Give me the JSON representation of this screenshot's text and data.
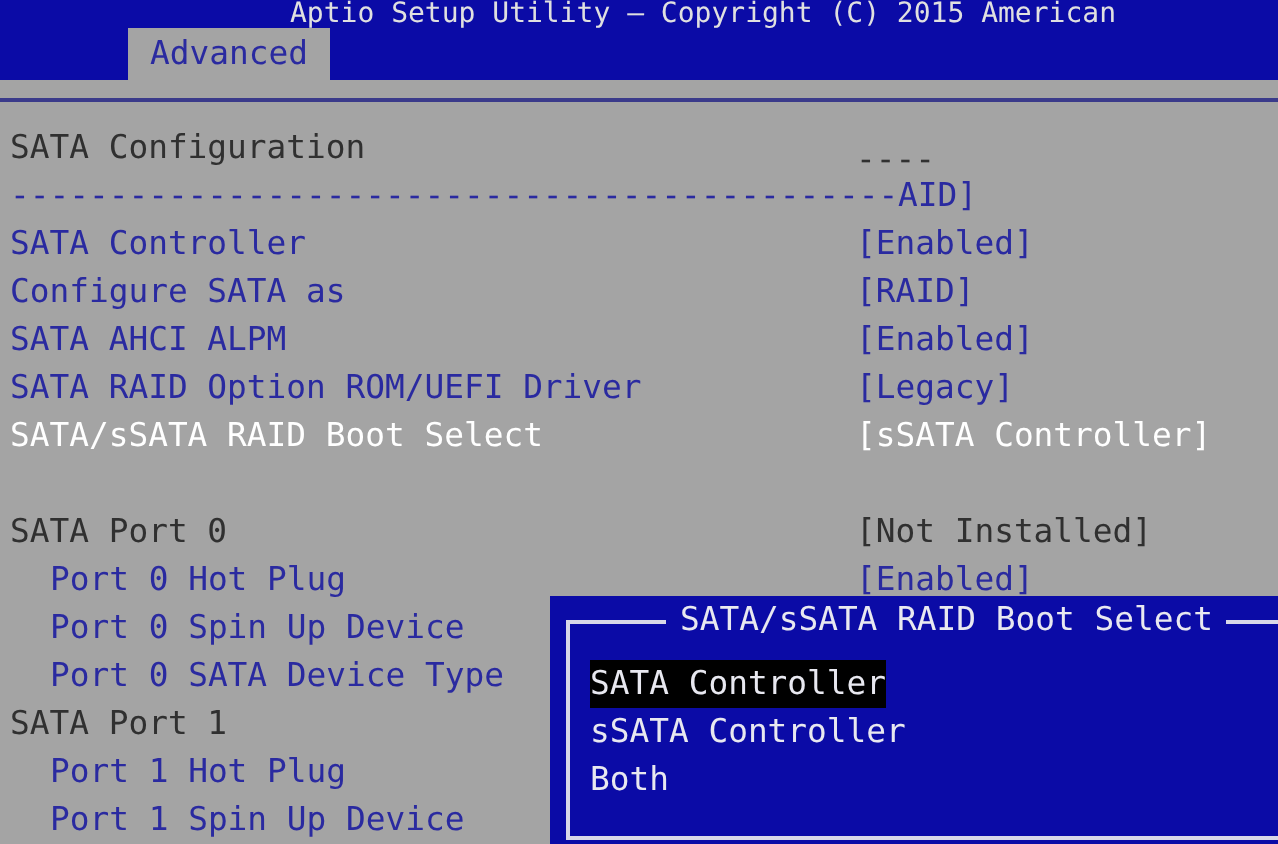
{
  "window": {
    "title": "Aptio Setup Utility – Copyright (C) 2015 American"
  },
  "tabs": [
    {
      "label": "Advanced",
      "selected": true
    }
  ],
  "page": {
    "title": "SATA Configuration",
    "help_fragment": "----",
    "divider_text": "---------------------------------------------AID]"
  },
  "items": [
    {
      "kind": "option",
      "label": "SATA Controller",
      "value": "[Enabled]",
      "selected": false
    },
    {
      "kind": "option",
      "label": "Configure SATA as",
      "value": "[RAID]",
      "selected": false
    },
    {
      "kind": "option",
      "label": "SATA AHCI ALPM",
      "value": "[Enabled]",
      "selected": false
    },
    {
      "kind": "option",
      "label": "SATA RAID Option ROM/UEFI Driver",
      "value": "[Legacy]",
      "selected": false
    },
    {
      "kind": "option",
      "label": "SATA/sSATA RAID Boot Select",
      "value": "[sSATA Controller]",
      "selected": true
    },
    {
      "kind": "spacer"
    },
    {
      "kind": "group",
      "label": "SATA Port 0",
      "value": "[Not Installed]",
      "children": [
        {
          "kind": "option",
          "label": "Port 0 Hot Plug",
          "value": "[Enabled]",
          "selected": false
        },
        {
          "kind": "option",
          "label": "Port 0 Spin Up Device",
          "selected": false
        },
        {
          "kind": "option",
          "label": "Port 0 SATA Device Type",
          "selected": false
        }
      ]
    },
    {
      "kind": "group",
      "label": "SATA Port 1",
      "children": [
        {
          "kind": "option",
          "label": "Port 1 Hot Plug",
          "selected": false
        },
        {
          "kind": "option",
          "label": "Port 1 Spin Up Device",
          "selected": false
        }
      ]
    }
  ],
  "popup": {
    "title": "SATA/sSATA RAID Boot Select",
    "options": [
      {
        "label": "SATA Controller",
        "selected": true
      },
      {
        "label": "sSATA Controller",
        "selected": false
      },
      {
        "label": "Both",
        "selected": false
      }
    ]
  }
}
